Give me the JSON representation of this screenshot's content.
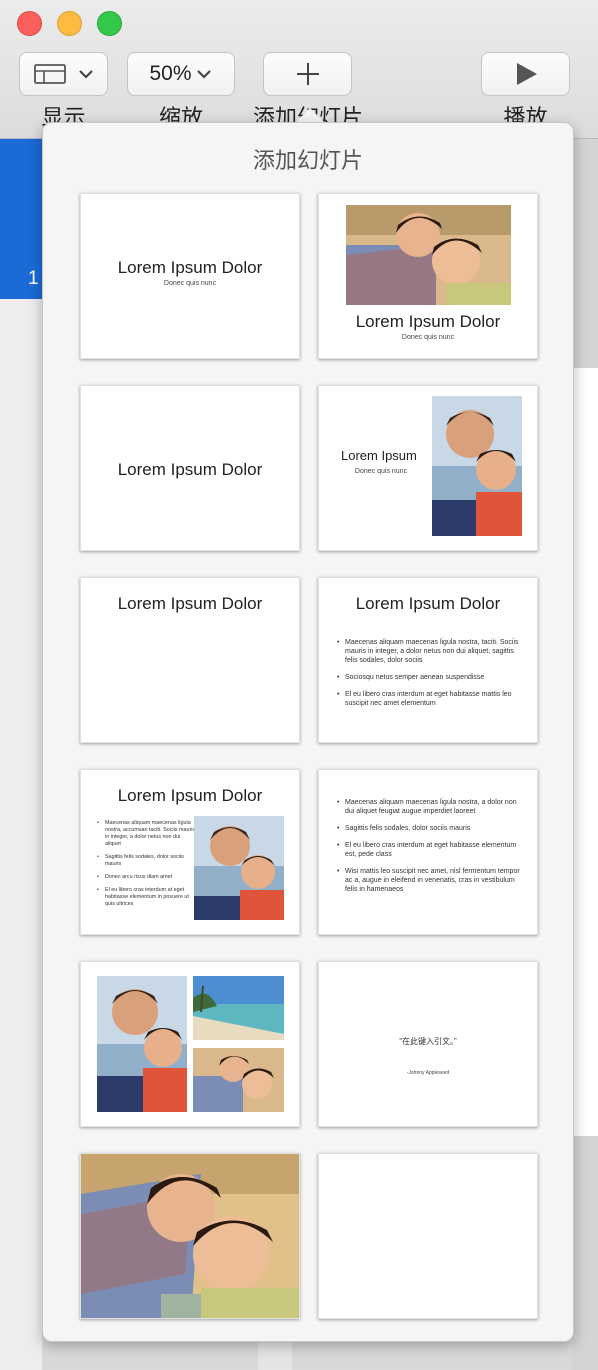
{
  "toolbar": {
    "view": {
      "label": "显示",
      "icon": "sidebar-icon"
    },
    "zoom": {
      "label": "缩放",
      "value": "50%"
    },
    "add_slide": {
      "label": "添加幻灯片",
      "icon": "plus-icon"
    },
    "play": {
      "label": "播放",
      "icon": "play-icon"
    }
  },
  "navigator": {
    "selected_slide_number": "1"
  },
  "popover": {
    "title": "添加幻灯片",
    "layouts": [
      {
        "title": "Lorem Ipsum Dolor",
        "subtitle": "Donec quis nunc"
      },
      {
        "title": "Lorem Ipsum Dolor",
        "subtitle": "Donec quis nunc"
      },
      {
        "title": "Lorem Ipsum Dolor"
      },
      {
        "title": "Lorem Ipsum",
        "subtitle": "Donec quis nunc"
      },
      {
        "title": "Lorem Ipsum Dolor"
      },
      {
        "title": "Lorem Ipsum Dolor",
        "bullets": [
          "Maecenas aliquam maecenas ligula nostra, taciti. Sociis mauris in integer, a dolor netus non dui aliquet, sagittis felis sodales, dolor sociis",
          "Sociosqu netus semper aenean suspendisse",
          "El eu libero cras interdum at eget habitasse mattis leo suscipit nec amet elementum"
        ]
      },
      {
        "title": "Lorem Ipsum Dolor",
        "bullets": [
          "Maecenas aliquam maecenas ligula nostra, accumsan taciti. Sociis mauris in integer, a dolor netus non dui aliquet",
          "Sagittis felis sodales, dolor sociis mauris",
          "Donec arcu risus diam amet",
          "El eu libero cras interdum at eget habitasse elementum in posuere ut quis ultrices"
        ]
      },
      {
        "bullets": [
          "Maecenas aliquam maecenas ligula nostra, a dolor non dui aliquet feugiat augue imperdiet laoreet",
          "Sagittis felis sodales, dolor sociis mauris",
          "El eu libero cras interdum at eget habitasse elementum est, pede class",
          "Wisi mattis leo suscipit nec amet, nisl fermentum tempor ac a, augue in eleifend in venenatis, cras in vestibulum felis in hamenaeos"
        ]
      },
      {},
      {
        "quote": "“在此键入引文。”",
        "author": "-Johnny Appleseed"
      },
      {},
      {}
    ]
  },
  "colors": {
    "accent": "#1b6ad6",
    "close": "#fc605c",
    "minimize": "#fdbc40",
    "maximize": "#34c84a"
  }
}
